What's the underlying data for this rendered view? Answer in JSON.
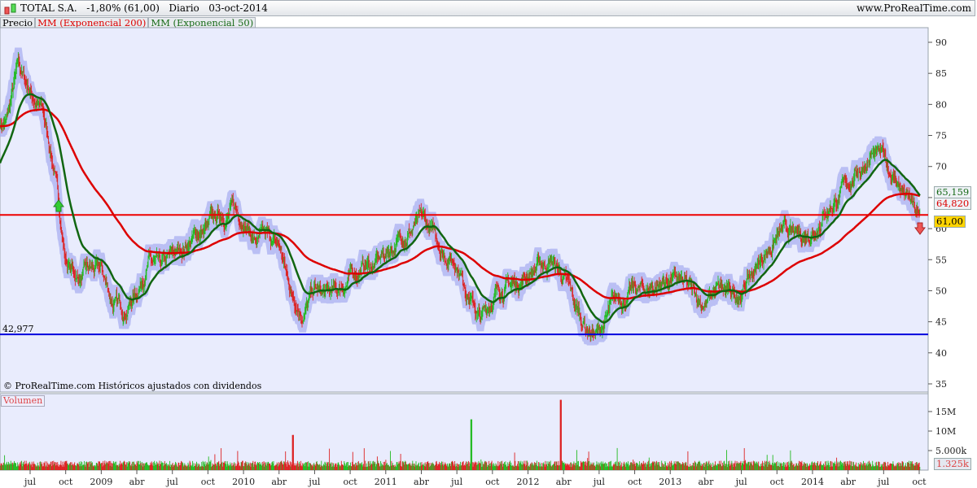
{
  "header": {
    "title": "TOTAL S.A.",
    "change": "-1,80% (61,00)",
    "period": "Diario",
    "date": "03-oct-2014",
    "site": "www.ProRealTime.com"
  },
  "legend": {
    "price": "Precio",
    "ema200": "MM (Exponencial 200)",
    "ema50": "MM (Exponencial 50)",
    "volume": "Volumen"
  },
  "footer_note": "© ProRealTime.com  Históricos ajustados con dividendos",
  "markers": {
    "ema50_value": "65,159",
    "ema200_value": "64,820",
    "last_price": "61,00",
    "last_volume": "1.325k",
    "support_value": "42,977"
  },
  "colors": {
    "up": "#22bb22",
    "down": "#dd2222",
    "ema200": "#dd0000",
    "ema50": "#116611",
    "band": "#aab0f0",
    "support": "#0000dd",
    "resistance": "#ee0000",
    "bg": "#e9ecfd"
  },
  "chart_data": {
    "type": "line",
    "title": "TOTAL S.A. Diario",
    "ylim": [
      33,
      93
    ],
    "yticks": [
      35,
      40,
      45,
      50,
      55,
      60,
      65,
      70,
      75,
      80,
      85,
      90
    ],
    "volume_ticks": [
      {
        "v": 5,
        "label": "5.000k"
      },
      {
        "v": 10,
        "label": "10M"
      },
      {
        "v": 15,
        "label": "15M"
      }
    ],
    "xticks": [
      "jul",
      "oct",
      "2009",
      "abr",
      "jul",
      "oct",
      "2010",
      "abr",
      "jul",
      "oct",
      "2011",
      "abr",
      "jul",
      "oct",
      "2012",
      "abr",
      "jul",
      "oct",
      "2013",
      "abr",
      "jul",
      "oct",
      "2014",
      "abr",
      "jul",
      "oct"
    ],
    "monthly_close_from_may_2008": [
      77,
      86,
      82,
      79,
      70,
      55,
      52,
      53,
      53,
      48,
      47,
      50,
      55,
      53,
      55,
      57,
      59,
      60,
      62,
      63,
      62,
      58,
      58,
      57,
      50,
      47,
      50,
      49,
      50,
      52,
      54,
      54,
      56,
      58,
      60,
      61,
      59,
      56,
      55,
      50,
      45,
      49,
      51,
      51,
      53,
      54,
      55,
      52,
      47,
      44,
      43,
      47,
      49,
      50,
      50,
      51,
      52,
      51,
      49,
      48,
      50,
      49,
      50,
      53,
      56,
      59,
      59,
      58,
      60,
      63,
      65,
      67,
      70,
      72,
      71,
      68,
      65,
      61
    ],
    "support_line": 42.977,
    "resistance_line": 62.2,
    "last": {
      "price": 61.0,
      "ema50": 65.159,
      "ema200": 64.82,
      "volume_k": 1325
    }
  }
}
